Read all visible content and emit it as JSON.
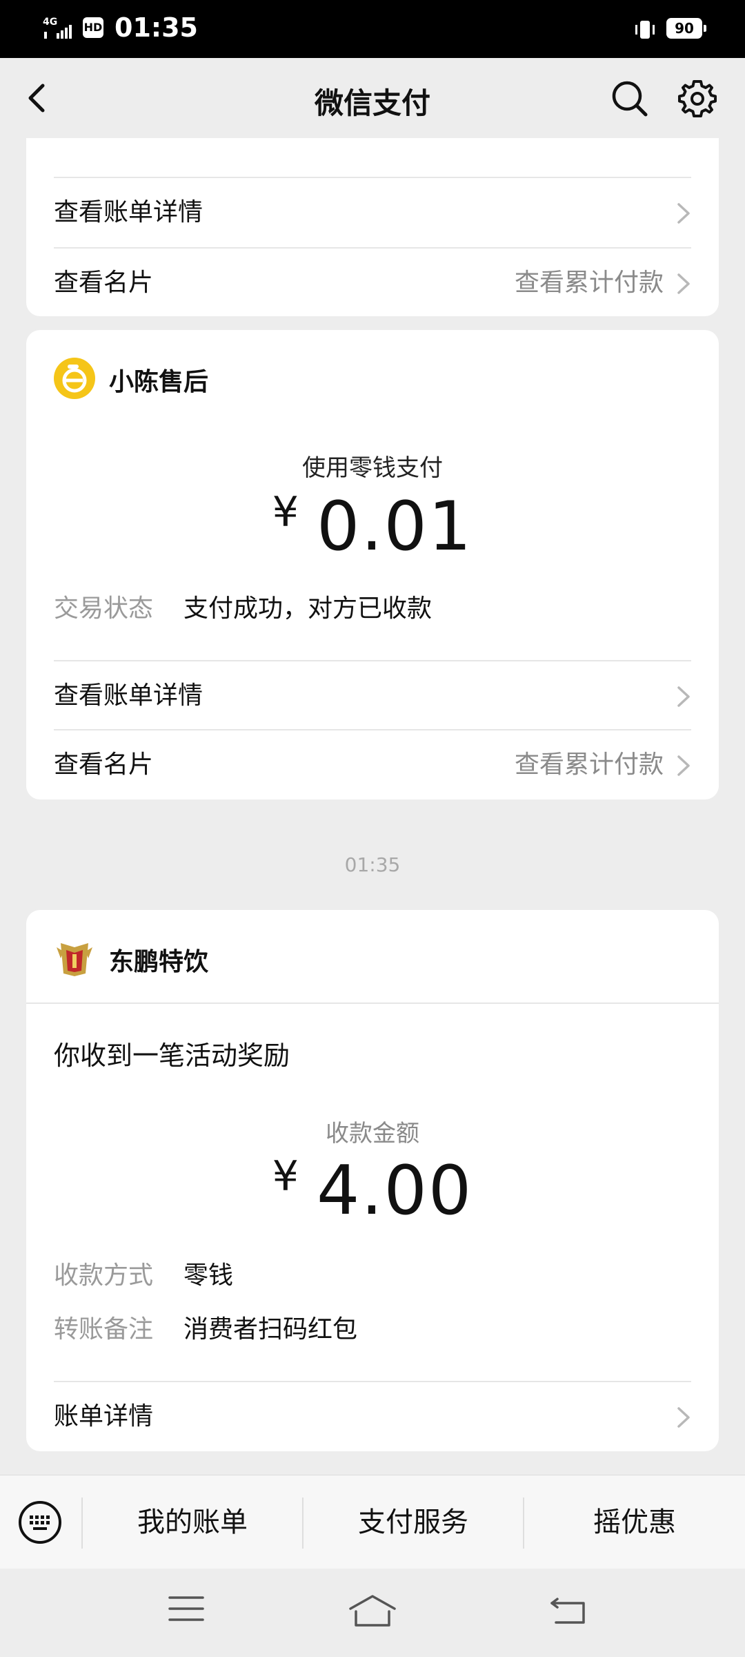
{
  "status_bar": {
    "network": "4G",
    "hd_label": "HD",
    "time": "01:35",
    "battery": "90"
  },
  "nav": {
    "title": "微信支付",
    "icons": [
      "back-arrow-icon",
      "search-icon",
      "gear-icon"
    ]
  },
  "card1": {
    "rows": [
      {
        "label": "查看账单详情",
        "right": ""
      },
      {
        "label": "查看名片",
        "right": "查看累计付款"
      }
    ]
  },
  "card2": {
    "merchant": "小陈售后",
    "method_caption": "使用零钱支付",
    "currency": "¥",
    "amount": "0.01",
    "status_label": "交易状态",
    "status_value": "支付成功，对方已收款",
    "rows": [
      {
        "label": "查看账单详情",
        "right": ""
      },
      {
        "label": "查看名片",
        "right": "查看累计付款"
      }
    ]
  },
  "timestamp": "01:35",
  "card3": {
    "merchant": "东鹏特饮",
    "headline": "你收到一笔活动奖励",
    "amount_caption": "收款金额",
    "currency": "¥",
    "amount": "4.00",
    "details": [
      {
        "label": "收款方式",
        "value": "零钱"
      },
      {
        "label": "转账备注",
        "value": "消费者扫码红包"
      }
    ],
    "row": {
      "label": "账单详情"
    }
  },
  "bottom_bar": {
    "tabs": [
      "我的账单",
      "支付服务",
      "摇优惠"
    ]
  },
  "colors": {
    "background": "#ededed",
    "card": "#ffffff",
    "accent_yellow": "#f5c518",
    "muted_text": "#8a8a8a"
  }
}
